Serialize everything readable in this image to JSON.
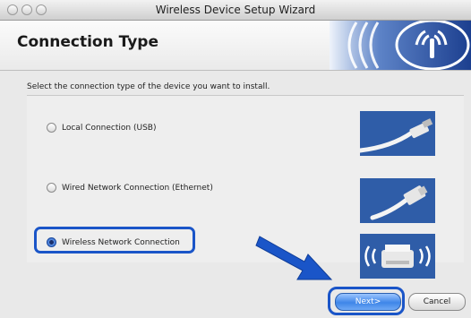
{
  "window": {
    "title": "Wireless Device Setup Wizard"
  },
  "header": {
    "title": "Connection Type"
  },
  "instruction": "Select the connection type of the device you want to install.",
  "options": [
    {
      "label": "Local Connection (USB)",
      "selected": false,
      "image": "usb-cable-icon"
    },
    {
      "label": "Wired Network Connection (Ethernet)",
      "selected": false,
      "image": "ethernet-cable-icon"
    },
    {
      "label": "Wireless Network Connection",
      "selected": true,
      "image": "wireless-printer-icon"
    }
  ],
  "buttons": {
    "next": "Next>",
    "cancel": "Cancel"
  },
  "colors": {
    "highlight": "#1a55c8",
    "accent": "#2c63c8"
  }
}
